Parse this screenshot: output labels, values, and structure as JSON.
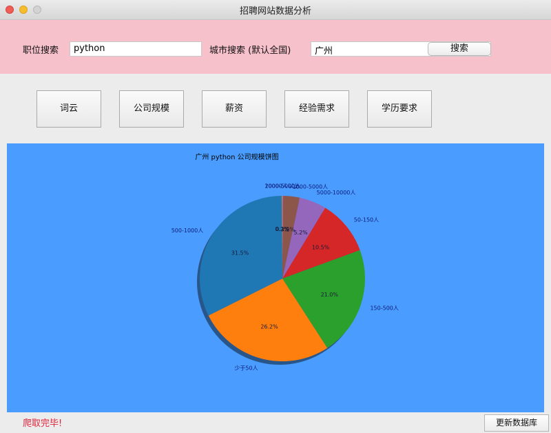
{
  "window": {
    "title": "招聘网站数据分析"
  },
  "search": {
    "job_label": "职位搜索",
    "job_value": "python",
    "city_label": "城市搜索 (默认全国)",
    "city_value": "广州",
    "search_button": "搜索"
  },
  "nav": {
    "wordcloud": "词云",
    "company_scale": "公司规模",
    "salary": "薪资",
    "experience": "经验需求",
    "education": "学历要求"
  },
  "status": {
    "text": "爬取完毕!"
  },
  "footer": {
    "update_db_button": "更新数据库"
  },
  "colors": {
    "searchbar_bg": "#f7c1cc",
    "chart_bg": "#4a9dfe",
    "status_text": "#e0243a"
  },
  "chart_data": {
    "type": "pie",
    "title": "广州 python 公司规模饼图",
    "start_angle": 90,
    "direction": "clockwise",
    "shadow": true,
    "slices": [
      {
        "label": "2000-5000人",
        "value": 0.1,
        "pct_label": "0.1%",
        "color": "#e377c2"
      },
      {
        "label": "1000-5000人",
        "value": 3.2,
        "pct_label": "3.2%",
        "color": "#8c564b"
      },
      {
        "label": "5000-10000人",
        "value": 5.2,
        "pct_label": "5.2%",
        "color": "#9467bd"
      },
      {
        "label": "50-150人",
        "value": 10.5,
        "pct_label": "10.5%",
        "color": "#d62728"
      },
      {
        "label": "150-500人",
        "value": 21.0,
        "pct_label": "21.0%",
        "color": "#2ca02c"
      },
      {
        "label": "少于50人",
        "value": 26.2,
        "pct_label": "26.2%",
        "color": "#ff7f0e"
      },
      {
        "label": "500-1000人",
        "value": 31.5,
        "pct_label": "31.5%",
        "color": "#1f77b4"
      },
      {
        "label": "10000人以上",
        "value": 0.2,
        "pct_label": "0.2%",
        "color": "#7f7f7f"
      }
    ]
  }
}
